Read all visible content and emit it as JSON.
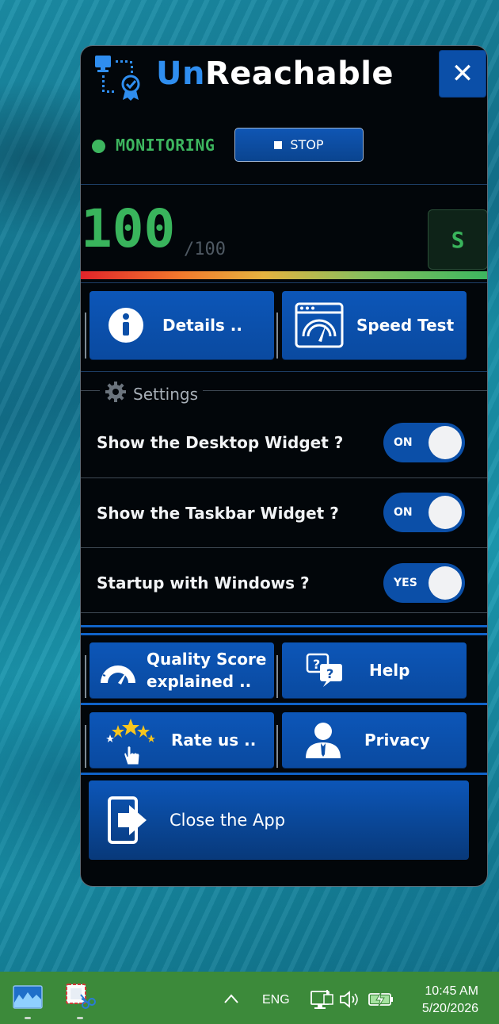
{
  "app": {
    "title_part1": "Un",
    "title_part2": "Reachable",
    "close_symbol": "✕",
    "logo_icon": "network-monitor-badge-icon"
  },
  "monitoring": {
    "status": "MONITORING",
    "status_color": "#3db65f",
    "stop_label": "STOP"
  },
  "score": {
    "value": "100",
    "max": "/100",
    "grade": "S",
    "fraction": 1.0
  },
  "actions": {
    "details_label": "Details ..",
    "speed_test_label": "Speed Test"
  },
  "settings": {
    "legend": "Settings",
    "rows": [
      {
        "label": "Show the Desktop Widget ?",
        "state": "ON"
      },
      {
        "label": "Show the Taskbar Widget ?",
        "state": "ON"
      },
      {
        "label": "Startup with Windows ?",
        "state": "YES"
      }
    ]
  },
  "bottom": {
    "quality_line1": "Quality Score",
    "quality_line2": "explained ..",
    "help_label": "Help",
    "rate_label": "Rate us ..",
    "privacy_label": "Privacy",
    "close_app_label": "Close the App"
  },
  "taskbar": {
    "language": "ENG",
    "time": "10:45 AM",
    "date": "5/20/2026",
    "chevron": "∧"
  },
  "colors": {
    "accent": "#0b4fa8",
    "title_blue": "#2f8ef0",
    "good_green": "#39b45c",
    "taskbar": "#3c8a3a"
  }
}
